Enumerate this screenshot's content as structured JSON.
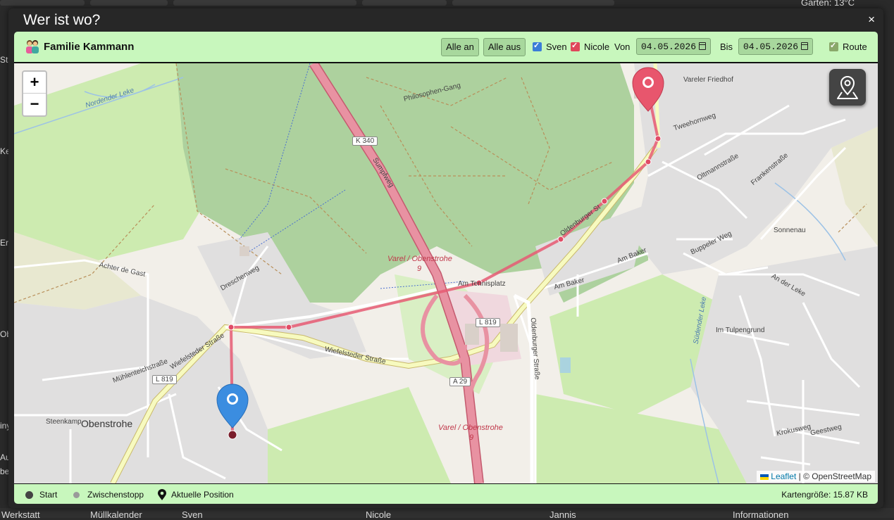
{
  "background": {
    "top_right_text": "Garten: 13°C",
    "left_fragments": [
      "Sta",
      "Ke",
      "Er",
      "Ob",
      "iny",
      "Au",
      "be"
    ],
    "bottom_tiles": [
      "Werkstatt",
      "Müllkalender",
      "Sven",
      "Nicole",
      "Jannis",
      "Informationen"
    ]
  },
  "modal": {
    "title": "Wer ist wo?",
    "close_label": "×"
  },
  "toolbar": {
    "family_name": "Familie Kammann",
    "all_on_label": "Alle an",
    "all_off_label": "Alle aus",
    "persons": [
      {
        "name": "Sven",
        "checked": true,
        "color": "#3b7dd8"
      },
      {
        "name": "Nicole",
        "checked": true,
        "color": "#e0475b"
      }
    ],
    "from_label": "Von",
    "from_date": "04.05.2026",
    "to_label": "Bis",
    "to_date": "04.05.2026",
    "route_label": "Route",
    "route_checked": true
  },
  "map": {
    "zoom_in": "+",
    "zoom_out": "−",
    "attribution_leaflet": "Leaflet",
    "attribution_osm": "| © OpenStreetMap",
    "labels": {
      "k340": "K 340",
      "sumpfweg": "Sumpfweg",
      "philosophen": "Philosophen-Gang",
      "varel1": "Varel / Obenstrohe",
      "nine1": "9",
      "l819a": "L 819",
      "l819b": "L 819",
      "a29": "A 29",
      "varel2": "Varel / Obenstrohe",
      "nine2": "9",
      "obenstrohe": "Obenstrohe",
      "wiefelsteder": "Wiefelsteder Straße",
      "wiefelsteder2": "Wiefelsteder Straße",
      "oldenburger": "Oldenburger Straße",
      "oldenburger_st": "Oldenburger St",
      "am_baker": "Am Baker",
      "am_baker2": "Am Baker",
      "vareler_friedhof": "Vareler Friedhof",
      "tweehornweg": "Tweehornweg",
      "buppeler_weg": "Buppeler Weg",
      "oltmannstrasse": "Oltmannstraße",
      "frankenstrasse": "Frankenstraße",
      "achter_de_gast": "Achter de Gast",
      "dreschenweg": "Dreschenweg",
      "muehlenteich": "Mühlenteichstraße",
      "norden_leke": "Nordender Leke",
      "suedender_leke": "Südender Leke",
      "steenkamp": "Steenkamp",
      "an_der_leke": "An der Leke",
      "im_tulpengrund": "Im Tulpengrund",
      "krokusweg": "Krokusweg",
      "geestweg": "Geestweg",
      "sonnenau": "Sonnenau",
      "am_tennisplatz": "Am Tennisplatz"
    }
  },
  "footer": {
    "legend": [
      {
        "label": "Start",
        "color": "#444444"
      },
      {
        "label": "Zwischenstopp",
        "color": "#9a9a9a"
      },
      {
        "label": "Aktuelle Position",
        "color": "#111111"
      }
    ],
    "map_size_label": "Kartengröße: 15.87 KB"
  }
}
